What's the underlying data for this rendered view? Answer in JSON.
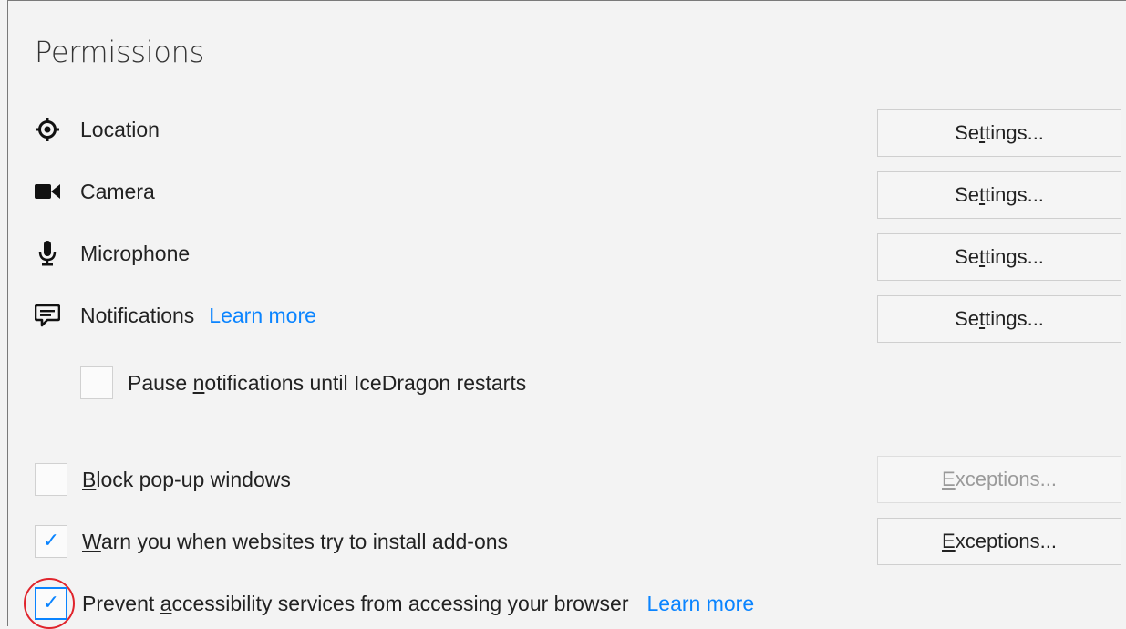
{
  "section": {
    "title": "Permissions"
  },
  "permissions": [
    {
      "label": "Location",
      "icon": "location-target-icon",
      "button": "Settings...",
      "button_mnemonic": "t"
    },
    {
      "label": "Camera",
      "icon": "camera-icon",
      "button": "Settings...",
      "button_mnemonic": "t"
    },
    {
      "label": "Microphone",
      "icon": "microphone-icon",
      "button": "Settings...",
      "button_mnemonic": "t"
    },
    {
      "label": "Notifications",
      "icon": "notification-speech-bubble-icon",
      "learn_more": "Learn more",
      "button": "Settings...",
      "button_mnemonic": "t"
    }
  ],
  "pause_notifications": {
    "label_prefix": "Pause ",
    "label_mnemonic": "n",
    "label_suffix": "otifications until IceDragon restarts",
    "checked": false
  },
  "block_popups": {
    "label_mnemonic": "B",
    "label_suffix": "lock pop-up windows",
    "checked": false,
    "button_mnemonic": "E",
    "button_suffix": "xceptions...",
    "button_enabled": false
  },
  "warn_addons": {
    "label_mnemonic": "W",
    "label_suffix": "arn you when websites try to install add-ons",
    "checked": true,
    "button_mnemonic": "E",
    "button_suffix": "xceptions...",
    "button_enabled": true
  },
  "prevent_accessibility": {
    "label_prefix": "Prevent ",
    "label_mnemonic": "a",
    "label_suffix": "ccessibility services from accessing your browser",
    "learn_more": "Learn more",
    "checked": true,
    "highlighted": true
  },
  "colors": {
    "link": "#0a84ff",
    "check": "#0a84ff",
    "annotation": "#e0242c"
  }
}
